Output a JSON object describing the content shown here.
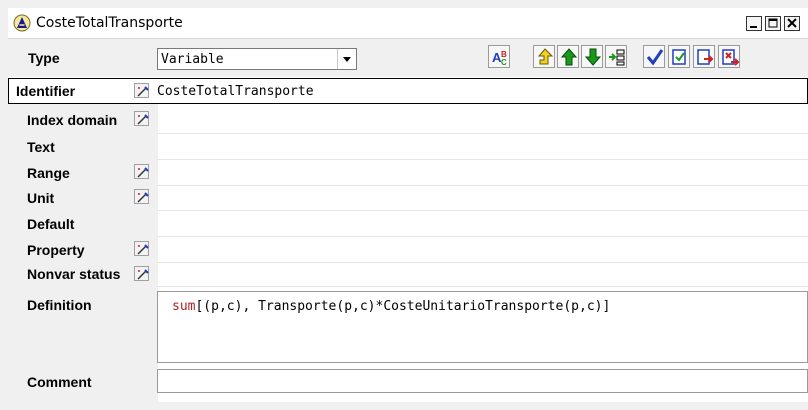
{
  "window": {
    "title": "CosteTotalTransporte",
    "icon": "aimms-app-icon",
    "controls": [
      "minimize-icon",
      "maximize-icon",
      "close-icon"
    ]
  },
  "type_row": {
    "label": "Type",
    "value": "Variable"
  },
  "toolbar": {
    "buttons": [
      "attribute-font-icon",
      "up-folder-icon",
      "move-up-icon",
      "move-down-icon",
      "insert-icon",
      "check-icon",
      "commit-icon",
      "commit-close-icon",
      "discard-close-icon"
    ]
  },
  "fields": {
    "identifier": {
      "label": "Identifier",
      "value": "CosteTotalTransporte"
    },
    "index_domain": {
      "label": "Index domain",
      "value": ""
    },
    "text": {
      "label": "Text",
      "value": ""
    },
    "range": {
      "label": "Range",
      "value": ""
    },
    "unit": {
      "label": "Unit",
      "value": ""
    },
    "default": {
      "label": "Default",
      "value": ""
    },
    "property": {
      "label": "Property",
      "value": ""
    },
    "nonvar_status": {
      "label": "Nonvar status",
      "value": ""
    },
    "definition": {
      "label": "Definition",
      "keyword": "sum",
      "rest": "[(p,c), Transporte(p,c)*CosteUnitarioTransporte(p,c)]"
    },
    "comment": {
      "label": "Comment",
      "value": ""
    }
  },
  "colors": {
    "keyword": "#b22222",
    "toolbar_green": "#1a9a1a",
    "toolbar_yellow": "#f0d020",
    "toolbar_red": "#d02020",
    "toolbar_blue": "#1f3fbf"
  }
}
